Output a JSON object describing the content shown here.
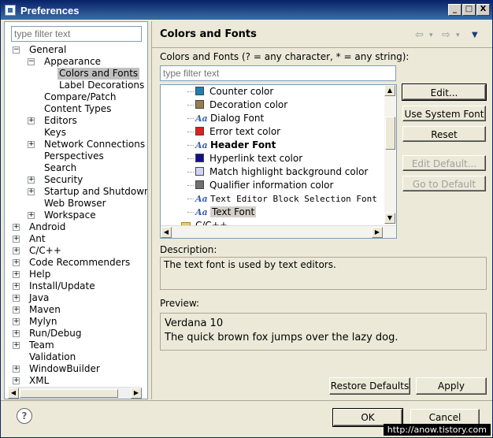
{
  "window": {
    "title": "Preferences",
    "min": "_",
    "max": "□",
    "close": "X"
  },
  "left": {
    "filter_placeholder": "type filter text",
    "tree": [
      {
        "label": "General",
        "level": 0,
        "expander": "−"
      },
      {
        "label": "Appearance",
        "level": 1,
        "expander": "−"
      },
      {
        "label": "Colors and Fonts",
        "level": 2,
        "expander": "",
        "selected": true
      },
      {
        "label": "Label Decorations",
        "level": 2,
        "expander": ""
      },
      {
        "label": "Compare/Patch",
        "level": 1,
        "expander": ""
      },
      {
        "label": "Content Types",
        "level": 1,
        "expander": ""
      },
      {
        "label": "Editors",
        "level": 1,
        "expander": "+"
      },
      {
        "label": "Keys",
        "level": 1,
        "expander": ""
      },
      {
        "label": "Network Connections",
        "level": 1,
        "expander": "+"
      },
      {
        "label": "Perspectives",
        "level": 1,
        "expander": ""
      },
      {
        "label": "Search",
        "level": 1,
        "expander": ""
      },
      {
        "label": "Security",
        "level": 1,
        "expander": "+"
      },
      {
        "label": "Startup and Shutdown",
        "level": 1,
        "expander": "+"
      },
      {
        "label": "Web Browser",
        "level": 1,
        "expander": ""
      },
      {
        "label": "Workspace",
        "level": 1,
        "expander": "+"
      },
      {
        "label": "Android",
        "level": 0,
        "expander": "+"
      },
      {
        "label": "Ant",
        "level": 0,
        "expander": "+"
      },
      {
        "label": "C/C++",
        "level": 0,
        "expander": "+"
      },
      {
        "label": "Code Recommenders",
        "level": 0,
        "expander": "+"
      },
      {
        "label": "Help",
        "level": 0,
        "expander": "+"
      },
      {
        "label": "Install/Update",
        "level": 0,
        "expander": "+"
      },
      {
        "label": "Java",
        "level": 0,
        "expander": "+"
      },
      {
        "label": "Maven",
        "level": 0,
        "expander": "+"
      },
      {
        "label": "Mylyn",
        "level": 0,
        "expander": "+"
      },
      {
        "label": "Run/Debug",
        "level": 0,
        "expander": "+"
      },
      {
        "label": "Team",
        "level": 0,
        "expander": "+"
      },
      {
        "label": "Validation",
        "level": 0,
        "expander": ""
      },
      {
        "label": "WindowBuilder",
        "level": 0,
        "expander": "+"
      },
      {
        "label": "XML",
        "level": 0,
        "expander": "+"
      }
    ]
  },
  "right": {
    "header": "Colors and Fonts",
    "nav_back": "⇦",
    "nav_back_menu": "▾",
    "nav_forward": "⇨",
    "nav_forward_menu": "▾",
    "nav_menu": "▼",
    "filter_label": "Colors and Fonts (? = any character, * = any string):",
    "filter_placeholder": "type filter text",
    "items": [
      {
        "label": "Counter color",
        "kind": "color",
        "color": "#1f7fb0"
      },
      {
        "label": "Decoration color",
        "kind": "color",
        "color": "#9a7b52"
      },
      {
        "label": "Dialog Font",
        "kind": "font"
      },
      {
        "label": "Error text color",
        "kind": "color",
        "color": "#e02020"
      },
      {
        "label": "Header Font",
        "kind": "font",
        "bold": true
      },
      {
        "label": "Hyperlink text color",
        "kind": "color",
        "color": "#10108a"
      },
      {
        "label": "Match highlight background color",
        "kind": "color",
        "color": "#d0d4f8"
      },
      {
        "label": "Qualifier information color",
        "kind": "color",
        "color": "#707070"
      },
      {
        "label": "Text Editor Block Selection Font",
        "kind": "font",
        "mono": true
      },
      {
        "label": "Text Font",
        "kind": "font",
        "selected": true
      },
      {
        "label": "C/C++",
        "kind": "folder"
      }
    ],
    "buttons": {
      "edit": "Edit...",
      "use_system_font": "Use System Font",
      "reset": "Reset",
      "edit_default": "Edit Default...",
      "go_to_default": "Go to Default"
    },
    "description_label": "Description:",
    "description_text": "The text font is used by text editors.",
    "preview_label": "Preview:",
    "preview_line1": "Verdana 10",
    "preview_line2": "The quick brown fox jumps over the lazy dog.",
    "restore_defaults": "Restore Defaults",
    "apply": "Apply"
  },
  "footer": {
    "help": "?",
    "ok": "OK",
    "cancel": "Cancel",
    "watermark": "http://anow.tistory.com"
  }
}
